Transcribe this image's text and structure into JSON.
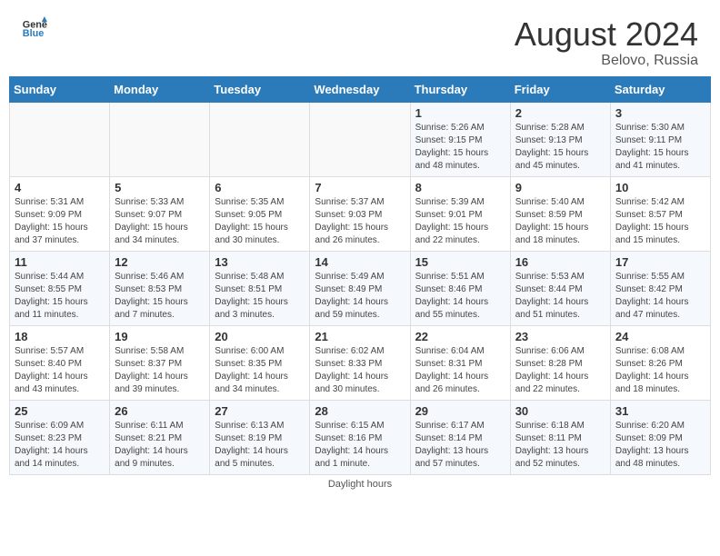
{
  "header": {
    "logo_text_general": "General",
    "logo_text_blue": "Blue",
    "title": "August 2024",
    "subtitle": "Belovo, Russia"
  },
  "calendar": {
    "days_of_week": [
      "Sunday",
      "Monday",
      "Tuesday",
      "Wednesday",
      "Thursday",
      "Friday",
      "Saturday"
    ],
    "weeks": [
      [
        {
          "day": "",
          "info": ""
        },
        {
          "day": "",
          "info": ""
        },
        {
          "day": "",
          "info": ""
        },
        {
          "day": "",
          "info": ""
        },
        {
          "day": "1",
          "info": "Sunrise: 5:26 AM\nSunset: 9:15 PM\nDaylight: 15 hours\nand 48 minutes."
        },
        {
          "day": "2",
          "info": "Sunrise: 5:28 AM\nSunset: 9:13 PM\nDaylight: 15 hours\nand 45 minutes."
        },
        {
          "day": "3",
          "info": "Sunrise: 5:30 AM\nSunset: 9:11 PM\nDaylight: 15 hours\nand 41 minutes."
        }
      ],
      [
        {
          "day": "4",
          "info": "Sunrise: 5:31 AM\nSunset: 9:09 PM\nDaylight: 15 hours\nand 37 minutes."
        },
        {
          "day": "5",
          "info": "Sunrise: 5:33 AM\nSunset: 9:07 PM\nDaylight: 15 hours\nand 34 minutes."
        },
        {
          "day": "6",
          "info": "Sunrise: 5:35 AM\nSunset: 9:05 PM\nDaylight: 15 hours\nand 30 minutes."
        },
        {
          "day": "7",
          "info": "Sunrise: 5:37 AM\nSunset: 9:03 PM\nDaylight: 15 hours\nand 26 minutes."
        },
        {
          "day": "8",
          "info": "Sunrise: 5:39 AM\nSunset: 9:01 PM\nDaylight: 15 hours\nand 22 minutes."
        },
        {
          "day": "9",
          "info": "Sunrise: 5:40 AM\nSunset: 8:59 PM\nDaylight: 15 hours\nand 18 minutes."
        },
        {
          "day": "10",
          "info": "Sunrise: 5:42 AM\nSunset: 8:57 PM\nDaylight: 15 hours\nand 15 minutes."
        }
      ],
      [
        {
          "day": "11",
          "info": "Sunrise: 5:44 AM\nSunset: 8:55 PM\nDaylight: 15 hours\nand 11 minutes."
        },
        {
          "day": "12",
          "info": "Sunrise: 5:46 AM\nSunset: 8:53 PM\nDaylight: 15 hours\nand 7 minutes."
        },
        {
          "day": "13",
          "info": "Sunrise: 5:48 AM\nSunset: 8:51 PM\nDaylight: 15 hours\nand 3 minutes."
        },
        {
          "day": "14",
          "info": "Sunrise: 5:49 AM\nSunset: 8:49 PM\nDaylight: 14 hours\nand 59 minutes."
        },
        {
          "day": "15",
          "info": "Sunrise: 5:51 AM\nSunset: 8:46 PM\nDaylight: 14 hours\nand 55 minutes."
        },
        {
          "day": "16",
          "info": "Sunrise: 5:53 AM\nSunset: 8:44 PM\nDaylight: 14 hours\nand 51 minutes."
        },
        {
          "day": "17",
          "info": "Sunrise: 5:55 AM\nSunset: 8:42 PM\nDaylight: 14 hours\nand 47 minutes."
        }
      ],
      [
        {
          "day": "18",
          "info": "Sunrise: 5:57 AM\nSunset: 8:40 PM\nDaylight: 14 hours\nand 43 minutes."
        },
        {
          "day": "19",
          "info": "Sunrise: 5:58 AM\nSunset: 8:37 PM\nDaylight: 14 hours\nand 39 minutes."
        },
        {
          "day": "20",
          "info": "Sunrise: 6:00 AM\nSunset: 8:35 PM\nDaylight: 14 hours\nand 34 minutes."
        },
        {
          "day": "21",
          "info": "Sunrise: 6:02 AM\nSunset: 8:33 PM\nDaylight: 14 hours\nand 30 minutes."
        },
        {
          "day": "22",
          "info": "Sunrise: 6:04 AM\nSunset: 8:31 PM\nDaylight: 14 hours\nand 26 minutes."
        },
        {
          "day": "23",
          "info": "Sunrise: 6:06 AM\nSunset: 8:28 PM\nDaylight: 14 hours\nand 22 minutes."
        },
        {
          "day": "24",
          "info": "Sunrise: 6:08 AM\nSunset: 8:26 PM\nDaylight: 14 hours\nand 18 minutes."
        }
      ],
      [
        {
          "day": "25",
          "info": "Sunrise: 6:09 AM\nSunset: 8:23 PM\nDaylight: 14 hours\nand 14 minutes."
        },
        {
          "day": "26",
          "info": "Sunrise: 6:11 AM\nSunset: 8:21 PM\nDaylight: 14 hours\nand 9 minutes."
        },
        {
          "day": "27",
          "info": "Sunrise: 6:13 AM\nSunset: 8:19 PM\nDaylight: 14 hours\nand 5 minutes."
        },
        {
          "day": "28",
          "info": "Sunrise: 6:15 AM\nSunset: 8:16 PM\nDaylight: 14 hours\nand 1 minute."
        },
        {
          "day": "29",
          "info": "Sunrise: 6:17 AM\nSunset: 8:14 PM\nDaylight: 13 hours\nand 57 minutes."
        },
        {
          "day": "30",
          "info": "Sunrise: 6:18 AM\nSunset: 8:11 PM\nDaylight: 13 hours\nand 52 minutes."
        },
        {
          "day": "31",
          "info": "Sunrise: 6:20 AM\nSunset: 8:09 PM\nDaylight: 13 hours\nand 48 minutes."
        }
      ]
    ],
    "footer_note": "Daylight hours"
  }
}
